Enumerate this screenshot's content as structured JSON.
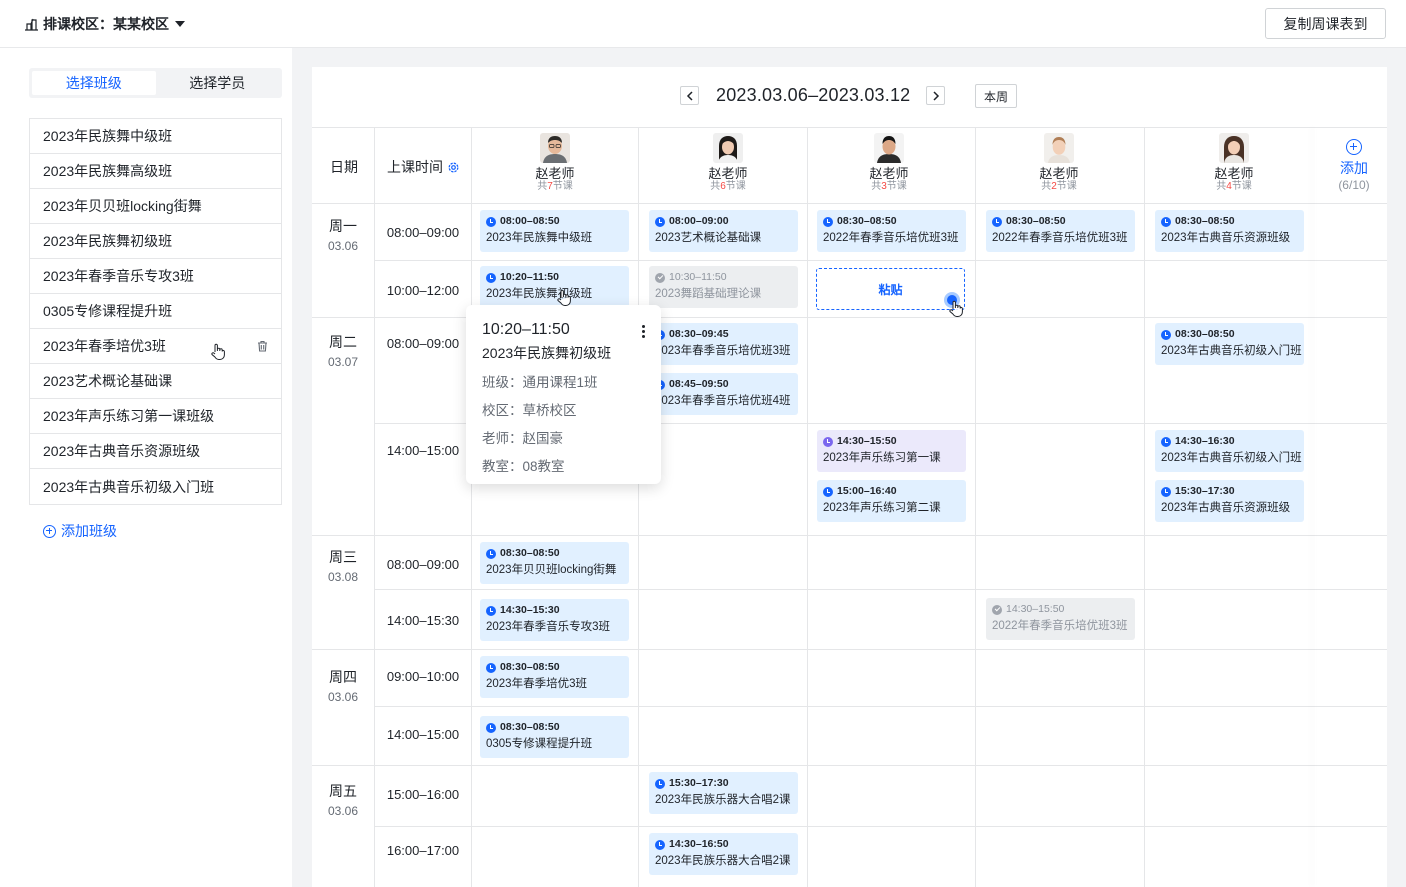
{
  "topbar": {
    "campus_label": "排课校区：",
    "campus_value": "某某校区",
    "copy_button": "复制周课表到"
  },
  "sidebar": {
    "tabs": [
      "选择班级",
      "选择学员"
    ],
    "active_tab": "选择班级",
    "classes": [
      "2023年民族舞中级班",
      "2023年民族舞高级班",
      "2023年贝贝班locking街舞",
      "2023年民族舞初级班",
      "2023年春季音乐专攻3班",
      "0305专修课程提升班",
      "2023年春季培优3班",
      "2023艺术概论基础课",
      "2023年声乐练习第一课班级",
      "2023年古典音乐资源班级",
      "2023年古典音乐初级入门班"
    ],
    "add_class": "添加班级"
  },
  "week": {
    "range": "2023.03.06–2023.03.12",
    "this_week": "本周"
  },
  "header": {
    "date_label": "日期",
    "time_label": "上课时间",
    "add_label": "添加",
    "add_count": "(6/10)"
  },
  "teachers": [
    {
      "name": "赵老师",
      "count_pre": "共",
      "count": "7",
      "count_post": "节课"
    },
    {
      "name": "赵老师",
      "count_pre": "共",
      "count": "6",
      "count_post": "节课"
    },
    {
      "name": "赵老师",
      "count_pre": "共",
      "count": "3",
      "count_post": "节课"
    },
    {
      "name": "赵老师",
      "count_pre": "共",
      "count": "2",
      "count_post": "节课"
    },
    {
      "name": "赵老师",
      "count_pre": "共",
      "count": "4",
      "count_post": "节课"
    }
  ],
  "days": [
    {
      "name": "周一",
      "date": "03.06"
    },
    {
      "name": "周二",
      "date": "03.07"
    },
    {
      "name": "周三",
      "date": "03.08"
    },
    {
      "name": "周四",
      "date": "03.06"
    },
    {
      "name": "周五",
      "date": "03.06"
    }
  ],
  "slots": [
    "08:00–09:00",
    "10:00–12:00",
    "08:00–09:00",
    "14:00–15:00",
    "08:00–09:00",
    "14:00–15:30",
    "09:00–10:00",
    "14:00–15:00",
    "15:00–16:00",
    "16:00–17:00"
  ],
  "cards": [
    {
      "time": "08:00–08:50",
      "name": "2023年民族舞中级班",
      "style": "blue"
    },
    {
      "time": "08:00–09:00",
      "name": "2023艺术概论基础课",
      "style": "blue"
    },
    {
      "time": "08:30–08:50",
      "name": "2022年春季音乐培优班3班",
      "style": "blue"
    },
    {
      "time": "08:30–08:50",
      "name": "2022年春季音乐培优班3班",
      "style": "blue"
    },
    {
      "time": "08:30–08:50",
      "name": "2023年古典音乐资源班级",
      "style": "blue"
    },
    {
      "time": "10:20–11:50",
      "name": "2023年民族舞初级班",
      "style": "blue"
    },
    {
      "time": "10:30–11:50",
      "name": "2023舞蹈基础理论课",
      "style": "gray"
    },
    {
      "time": "08:30–09:45",
      "name": "2023年春季音乐培优班3班",
      "style": "blue"
    },
    {
      "time": "08:45–09:50",
      "name": "2023年春季音乐培优班4班",
      "style": "blue"
    },
    {
      "time": "08:30–08:50",
      "name": "2023年古典音乐初级入门班",
      "style": "blue"
    },
    {
      "time": "14:30–15:50",
      "name": "2023年声乐练习第一课",
      "style": "purple"
    },
    {
      "time": "15:00–16:40",
      "name": "2023年声乐练习第二课",
      "style": "blue"
    },
    {
      "time": "14:30–16:30",
      "name": "2023年古典音乐初级入门班",
      "style": "blue"
    },
    {
      "time": "15:30–17:30",
      "name": "2023年古典音乐资源班级",
      "style": "blue"
    },
    {
      "time": "08:30–08:50",
      "name": "2023年贝贝班locking街舞",
      "style": "blue"
    },
    {
      "time": "14:30–15:30",
      "name": "2023年春季音乐专攻3班",
      "style": "blue"
    },
    {
      "time": "14:30–15:50",
      "name": "2022年春季音乐培优班3班",
      "style": "gray"
    },
    {
      "time": "08:30–08:50",
      "name": "2023年春季培优3班",
      "style": "blue"
    },
    {
      "time": "08:30–08:50",
      "name": "0305专修课程提升班",
      "style": "blue"
    },
    {
      "time": "15:30–17:30",
      "name": "2023年民族乐器大合唱2课",
      "style": "blue"
    },
    {
      "time": "14:30–16:50",
      "name": "2023年民族乐器大合唱2课",
      "style": "blue"
    }
  ],
  "paste_label": "粘贴",
  "popover": {
    "time": "10:20–11:50",
    "name": "2023年民族舞初级班",
    "rows": [
      "班级：通用课程1班",
      "校区：草桥校区",
      "老师：赵国豪",
      "教室：08教室"
    ]
  }
}
